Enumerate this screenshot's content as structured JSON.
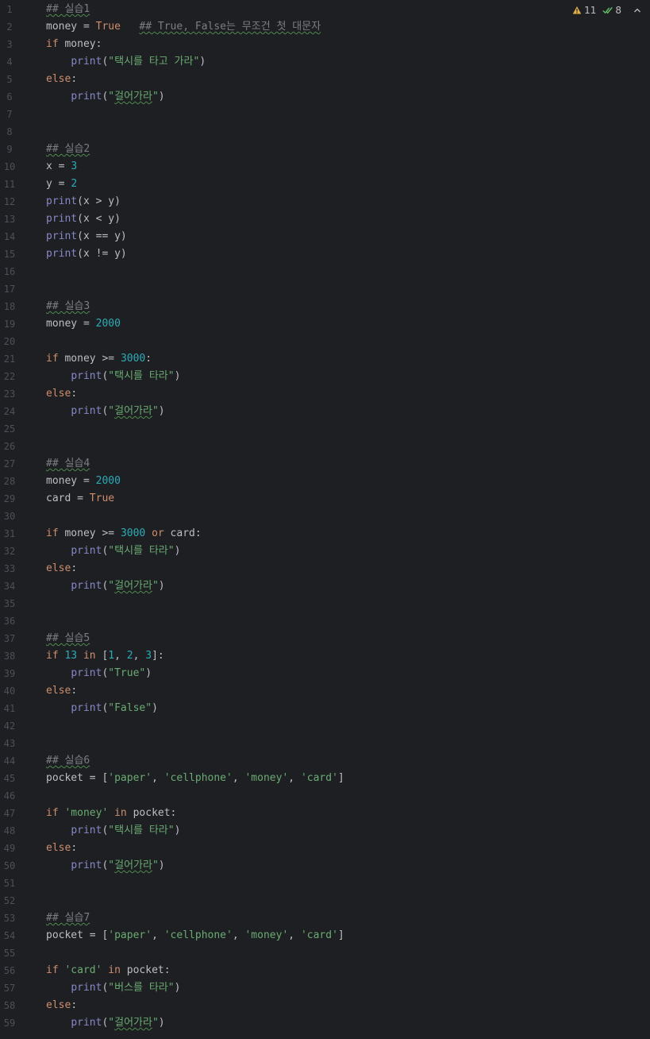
{
  "inspection": {
    "warnings_count": "11",
    "checks_count": "8"
  },
  "colors": {
    "background": "#1e1f22",
    "keyword": "#cf8e6d",
    "number": "#2aacb8",
    "string": "#6aab73",
    "builtin": "#8888c6",
    "comment": "#7a7e85",
    "plain": "#bcbec4",
    "line_number": "#4b5059",
    "typo_underline": "#4d8a4d",
    "warning": "#e0b04a"
  },
  "lines": [
    {
      "n": "1",
      "tokens": [
        {
          "t": "## 실습1",
          "c": "c",
          "w": true
        }
      ]
    },
    {
      "n": "2",
      "tokens": [
        {
          "t": "money = ",
          "c": "p"
        },
        {
          "t": "True",
          "c": "k"
        },
        {
          "t": "   ",
          "c": "p"
        },
        {
          "t": "## True, False는 무조건 첫 대문자",
          "c": "c",
          "w": true
        }
      ]
    },
    {
      "n": "3",
      "tokens": [
        {
          "t": "if",
          "c": "k"
        },
        {
          "t": " money:",
          "c": "p"
        }
      ]
    },
    {
      "n": "4",
      "tokens": [
        {
          "t": "    ",
          "c": "p"
        },
        {
          "t": "print",
          "c": "b"
        },
        {
          "t": "(",
          "c": "p"
        },
        {
          "t": "\"택시를 타고 가라\"",
          "c": "s"
        },
        {
          "t": ")",
          "c": "p"
        }
      ]
    },
    {
      "n": "5",
      "tokens": [
        {
          "t": "else",
          "c": "k"
        },
        {
          "t": ":",
          "c": "p"
        }
      ]
    },
    {
      "n": "6",
      "tokens": [
        {
          "t": "    ",
          "c": "p"
        },
        {
          "t": "print",
          "c": "b"
        },
        {
          "t": "(",
          "c": "p"
        },
        {
          "t": "\"",
          "c": "s"
        },
        {
          "t": "걸어가라",
          "c": "s",
          "w": true
        },
        {
          "t": "\"",
          "c": "s"
        },
        {
          "t": ")",
          "c": "p"
        }
      ]
    },
    {
      "n": "7",
      "tokens": []
    },
    {
      "n": "8",
      "tokens": []
    },
    {
      "n": "9",
      "tokens": [
        {
          "t": "## 실습2",
          "c": "c",
          "w": true
        }
      ]
    },
    {
      "n": "10",
      "tokens": [
        {
          "t": "x = ",
          "c": "p"
        },
        {
          "t": "3",
          "c": "n"
        }
      ]
    },
    {
      "n": "11",
      "tokens": [
        {
          "t": "y = ",
          "c": "p"
        },
        {
          "t": "2",
          "c": "n"
        }
      ]
    },
    {
      "n": "12",
      "tokens": [
        {
          "t": "print",
          "c": "b"
        },
        {
          "t": "(x > y)",
          "c": "p"
        }
      ]
    },
    {
      "n": "13",
      "tokens": [
        {
          "t": "print",
          "c": "b"
        },
        {
          "t": "(x < y)",
          "c": "p"
        }
      ]
    },
    {
      "n": "14",
      "tokens": [
        {
          "t": "print",
          "c": "b"
        },
        {
          "t": "(x == y)",
          "c": "p"
        }
      ]
    },
    {
      "n": "15",
      "tokens": [
        {
          "t": "print",
          "c": "b"
        },
        {
          "t": "(x != y)",
          "c": "p"
        }
      ]
    },
    {
      "n": "16",
      "tokens": []
    },
    {
      "n": "17",
      "tokens": []
    },
    {
      "n": "18",
      "tokens": [
        {
          "t": "## 실습3",
          "c": "c",
          "w": true
        }
      ]
    },
    {
      "n": "19",
      "tokens": [
        {
          "t": "money = ",
          "c": "p"
        },
        {
          "t": "2000",
          "c": "n"
        }
      ]
    },
    {
      "n": "20",
      "tokens": []
    },
    {
      "n": "21",
      "tokens": [
        {
          "t": "if",
          "c": "k"
        },
        {
          "t": " money >= ",
          "c": "p"
        },
        {
          "t": "3000",
          "c": "n"
        },
        {
          "t": ":",
          "c": "p"
        }
      ]
    },
    {
      "n": "22",
      "tokens": [
        {
          "t": "    ",
          "c": "p"
        },
        {
          "t": "print",
          "c": "b"
        },
        {
          "t": "(",
          "c": "p"
        },
        {
          "t": "\"택시를 타라\"",
          "c": "s"
        },
        {
          "t": ")",
          "c": "p"
        }
      ]
    },
    {
      "n": "23",
      "tokens": [
        {
          "t": "else",
          "c": "k"
        },
        {
          "t": ":",
          "c": "p"
        }
      ]
    },
    {
      "n": "24",
      "tokens": [
        {
          "t": "    ",
          "c": "p"
        },
        {
          "t": "print",
          "c": "b"
        },
        {
          "t": "(",
          "c": "p"
        },
        {
          "t": "\"",
          "c": "s"
        },
        {
          "t": "걸어가라",
          "c": "s",
          "w": true
        },
        {
          "t": "\"",
          "c": "s"
        },
        {
          "t": ")",
          "c": "p"
        }
      ]
    },
    {
      "n": "25",
      "tokens": []
    },
    {
      "n": "26",
      "tokens": []
    },
    {
      "n": "27",
      "tokens": [
        {
          "t": "## 실습4",
          "c": "c",
          "w": true
        }
      ]
    },
    {
      "n": "28",
      "tokens": [
        {
          "t": "money = ",
          "c": "p"
        },
        {
          "t": "2000",
          "c": "n"
        }
      ]
    },
    {
      "n": "29",
      "tokens": [
        {
          "t": "card = ",
          "c": "p"
        },
        {
          "t": "True",
          "c": "k"
        }
      ]
    },
    {
      "n": "30",
      "tokens": []
    },
    {
      "n": "31",
      "tokens": [
        {
          "t": "if",
          "c": "k"
        },
        {
          "t": " money >= ",
          "c": "p"
        },
        {
          "t": "3000",
          "c": "n"
        },
        {
          "t": " ",
          "c": "p"
        },
        {
          "t": "or",
          "c": "k"
        },
        {
          "t": " card:",
          "c": "p"
        }
      ]
    },
    {
      "n": "32",
      "tokens": [
        {
          "t": "    ",
          "c": "p"
        },
        {
          "t": "print",
          "c": "b"
        },
        {
          "t": "(",
          "c": "p"
        },
        {
          "t": "\"택시를 타라\"",
          "c": "s"
        },
        {
          "t": ")",
          "c": "p"
        }
      ]
    },
    {
      "n": "33",
      "tokens": [
        {
          "t": "else",
          "c": "k"
        },
        {
          "t": ":",
          "c": "p"
        }
      ]
    },
    {
      "n": "34",
      "tokens": [
        {
          "t": "    ",
          "c": "p"
        },
        {
          "t": "print",
          "c": "b"
        },
        {
          "t": "(",
          "c": "p"
        },
        {
          "t": "\"",
          "c": "s"
        },
        {
          "t": "걸어가라",
          "c": "s",
          "w": true
        },
        {
          "t": "\"",
          "c": "s"
        },
        {
          "t": ")",
          "c": "p"
        }
      ]
    },
    {
      "n": "35",
      "tokens": []
    },
    {
      "n": "36",
      "tokens": []
    },
    {
      "n": "37",
      "tokens": [
        {
          "t": "## 실습5",
          "c": "c",
          "w": true
        }
      ]
    },
    {
      "n": "38",
      "tokens": [
        {
          "t": "if",
          "c": "k"
        },
        {
          "t": " ",
          "c": "p"
        },
        {
          "t": "13",
          "c": "n"
        },
        {
          "t": " ",
          "c": "p"
        },
        {
          "t": "in",
          "c": "k"
        },
        {
          "t": " [",
          "c": "p"
        },
        {
          "t": "1",
          "c": "n"
        },
        {
          "t": ", ",
          "c": "p"
        },
        {
          "t": "2",
          "c": "n"
        },
        {
          "t": ", ",
          "c": "p"
        },
        {
          "t": "3",
          "c": "n"
        },
        {
          "t": "]:",
          "c": "p"
        }
      ]
    },
    {
      "n": "39",
      "tokens": [
        {
          "t": "    ",
          "c": "p"
        },
        {
          "t": "print",
          "c": "b"
        },
        {
          "t": "(",
          "c": "p"
        },
        {
          "t": "\"True\"",
          "c": "s"
        },
        {
          "t": ")",
          "c": "p"
        }
      ]
    },
    {
      "n": "40",
      "tokens": [
        {
          "t": "else",
          "c": "k"
        },
        {
          "t": ":",
          "c": "p"
        }
      ]
    },
    {
      "n": "41",
      "tokens": [
        {
          "t": "    ",
          "c": "p"
        },
        {
          "t": "print",
          "c": "b"
        },
        {
          "t": "(",
          "c": "p"
        },
        {
          "t": "\"False\"",
          "c": "s"
        },
        {
          "t": ")",
          "c": "p"
        }
      ]
    },
    {
      "n": "42",
      "tokens": []
    },
    {
      "n": "43",
      "tokens": []
    },
    {
      "n": "44",
      "tokens": [
        {
          "t": "## 실습6",
          "c": "c",
          "w": true
        }
      ]
    },
    {
      "n": "45",
      "tokens": [
        {
          "t": "pocket = [",
          "c": "p"
        },
        {
          "t": "'paper'",
          "c": "s"
        },
        {
          "t": ", ",
          "c": "p"
        },
        {
          "t": "'cellphone'",
          "c": "s"
        },
        {
          "t": ", ",
          "c": "p"
        },
        {
          "t": "'money'",
          "c": "s"
        },
        {
          "t": ", ",
          "c": "p"
        },
        {
          "t": "'card'",
          "c": "s"
        },
        {
          "t": "]",
          "c": "p"
        }
      ]
    },
    {
      "n": "46",
      "tokens": []
    },
    {
      "n": "47",
      "tokens": [
        {
          "t": "if",
          "c": "k"
        },
        {
          "t": " ",
          "c": "p"
        },
        {
          "t": "'money'",
          "c": "s"
        },
        {
          "t": " ",
          "c": "p"
        },
        {
          "t": "in",
          "c": "k"
        },
        {
          "t": " pocket:",
          "c": "p"
        }
      ]
    },
    {
      "n": "48",
      "tokens": [
        {
          "t": "    ",
          "c": "p"
        },
        {
          "t": "print",
          "c": "b"
        },
        {
          "t": "(",
          "c": "p"
        },
        {
          "t": "\"택시를 타라\"",
          "c": "s"
        },
        {
          "t": ")",
          "c": "p"
        }
      ]
    },
    {
      "n": "49",
      "tokens": [
        {
          "t": "else",
          "c": "k"
        },
        {
          "t": ":",
          "c": "p"
        }
      ]
    },
    {
      "n": "50",
      "tokens": [
        {
          "t": "    ",
          "c": "p"
        },
        {
          "t": "print",
          "c": "b"
        },
        {
          "t": "(",
          "c": "p"
        },
        {
          "t": "\"",
          "c": "s"
        },
        {
          "t": "걸어가라",
          "c": "s",
          "w": true
        },
        {
          "t": "\"",
          "c": "s"
        },
        {
          "t": ")",
          "c": "p"
        }
      ]
    },
    {
      "n": "51",
      "tokens": []
    },
    {
      "n": "52",
      "tokens": []
    },
    {
      "n": "53",
      "tokens": [
        {
          "t": "## 실습7",
          "c": "c",
          "w": true
        }
      ]
    },
    {
      "n": "54",
      "tokens": [
        {
          "t": "pocket = [",
          "c": "p"
        },
        {
          "t": "'paper'",
          "c": "s"
        },
        {
          "t": ", ",
          "c": "p"
        },
        {
          "t": "'cellphone'",
          "c": "s"
        },
        {
          "t": ", ",
          "c": "p"
        },
        {
          "t": "'money'",
          "c": "s"
        },
        {
          "t": ", ",
          "c": "p"
        },
        {
          "t": "'card'",
          "c": "s"
        },
        {
          "t": "]",
          "c": "p"
        }
      ]
    },
    {
      "n": "55",
      "tokens": []
    },
    {
      "n": "56",
      "tokens": [
        {
          "t": "if",
          "c": "k"
        },
        {
          "t": " ",
          "c": "p"
        },
        {
          "t": "'card'",
          "c": "s"
        },
        {
          "t": " ",
          "c": "p"
        },
        {
          "t": "in",
          "c": "k"
        },
        {
          "t": " pocket:",
          "c": "p"
        }
      ]
    },
    {
      "n": "57",
      "tokens": [
        {
          "t": "    ",
          "c": "p"
        },
        {
          "t": "print",
          "c": "b"
        },
        {
          "t": "(",
          "c": "p"
        },
        {
          "t": "\"버스를 타라\"",
          "c": "s"
        },
        {
          "t": ")",
          "c": "p"
        }
      ]
    },
    {
      "n": "58",
      "tokens": [
        {
          "t": "else",
          "c": "k"
        },
        {
          "t": ":",
          "c": "p"
        }
      ]
    },
    {
      "n": "59",
      "tokens": [
        {
          "t": "    ",
          "c": "p"
        },
        {
          "t": "print",
          "c": "b"
        },
        {
          "t": "(",
          "c": "p"
        },
        {
          "t": "\"",
          "c": "s"
        },
        {
          "t": "걸어가라",
          "c": "s",
          "w": true
        },
        {
          "t": "\"",
          "c": "s"
        },
        {
          "t": ")",
          "c": "p"
        }
      ]
    }
  ]
}
